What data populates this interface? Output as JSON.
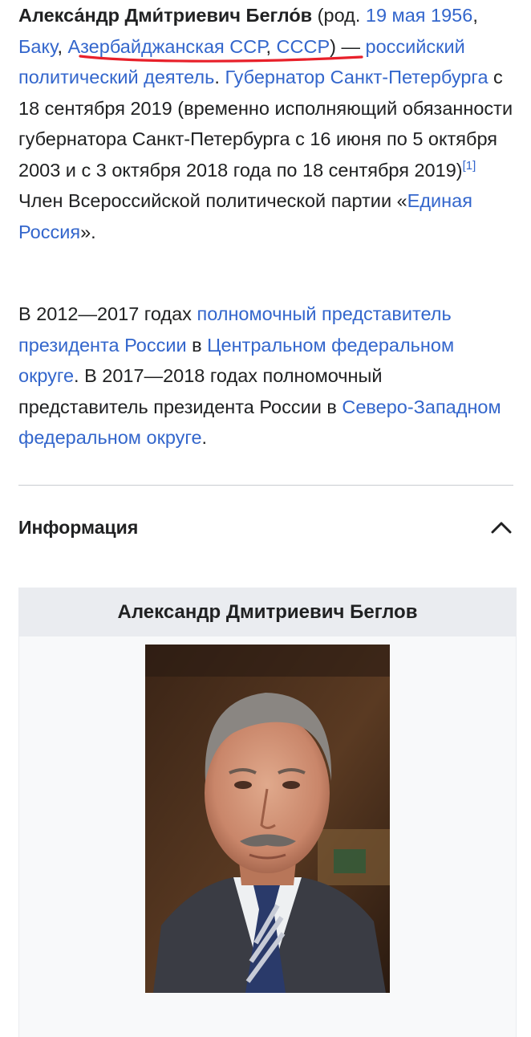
{
  "intro": {
    "name": "Алекса́ндр Дми́триевич Бегло́в",
    "born_open": " (род. ",
    "born_date_link": "19 мая 1956",
    "comma1": ", ",
    "city_link": "Баку",
    "comma2": ", ",
    "republic_link": "Азербайджанская ССР",
    "comma3": ", ",
    "country_link": "СССР",
    "born_close": ") — ",
    "role_link": "российский политический деятель",
    "dot1": ". ",
    "governor_link": "Губернатор Санкт-Петербурга",
    "text_after_governor": " с 18 сентября 2019 (временно исполняющий обязанности губернатора Санкт-Петербурга с 16 июня по 5 октября 2003 и с 3 октября 2018 года по 18 сентября 2019)",
    "ref1": "[1]",
    "text_member": " Член Всероссийской политической партии «",
    "party_link": "Единая Россия",
    "text_end": "»."
  },
  "second": {
    "text1": "В 2012—2017 годах ",
    "envoy_link": "полномочный представитель президента России",
    "text2": " в ",
    "cfo_link": "Центральном федеральном округе",
    "text3": ". В 2017—2018 годах полномочный представитель президента России в ",
    "szfo_link": "Северо-Западном федеральном округе",
    "text4": "."
  },
  "info_section": {
    "title": "Информация",
    "toggle_icon": "chevron-up-icon"
  },
  "infobox": {
    "title": "Александр Дмитриевич Беглов",
    "photo": "portrait-photo"
  },
  "colors": {
    "link": "#3366cc",
    "text": "#202122",
    "annotation_underline": "#e8202a"
  }
}
